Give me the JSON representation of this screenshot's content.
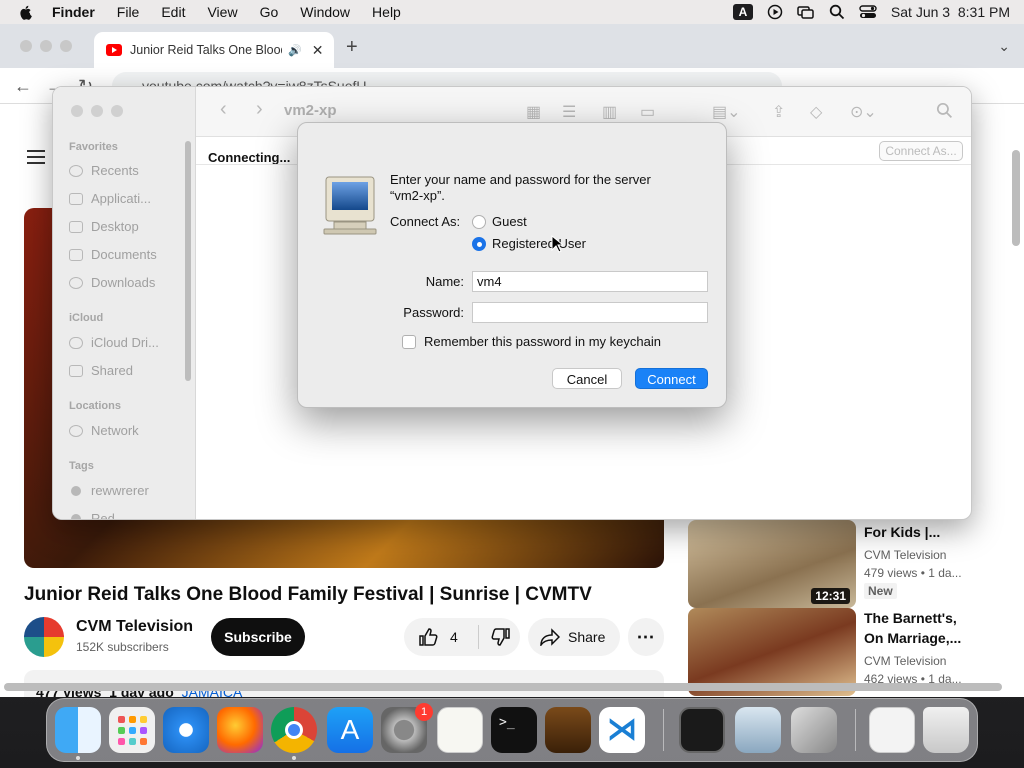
{
  "menubar": {
    "app_name": "Finder",
    "items": [
      "File",
      "Edit",
      "View",
      "Go",
      "Window",
      "Help"
    ],
    "input_source": "A",
    "datetime": "Sat Jun 3  8:31 PM"
  },
  "browser": {
    "tab_title": "Junior Reid Talks One Blood Family Festival | Sunrise | CVMTV",
    "url": "youtube.com/watch?v=jw8zTsSuefU"
  },
  "youtube": {
    "video_title": "Junior Reid Talks One Blood Family Festival | Sunrise | CVMTV",
    "channel_name": "CVM Television",
    "subscribers": "152K subscribers",
    "subscribe_label": "Subscribe",
    "likes": "4",
    "share_label": "Share",
    "views_date": "477 views  1 day ago",
    "location": "JAMAICA",
    "related": [
      {
        "title": "For Kids |...",
        "channel": "CVM Television",
        "meta": "479 views  • 1 da...",
        "duration": "12:31",
        "badge": "New"
      },
      {
        "title": "The Barnett's, On Marriage,...",
        "channel": "CVM Television",
        "meta": "462 views  • 1 da..."
      }
    ]
  },
  "finder": {
    "title": "vm2-xp",
    "status": "Connecting...",
    "connect_as_label": "Connect As...",
    "sidebar": {
      "favorites_header": "Favorites",
      "favorites": [
        "Recents",
        "Applicati...",
        "Desktop",
        "Documents",
        "Downloads"
      ],
      "icloud_header": "iCloud",
      "icloud": [
        "iCloud Dri...",
        "Shared"
      ],
      "locations_header": "Locations",
      "locations": [
        "Network"
      ],
      "tags_header": "Tags",
      "tags": [
        "rewwrerer",
        "Red"
      ]
    }
  },
  "dialog": {
    "message_line1": "Enter your name and password for the server",
    "message_line2": "“vm2-xp”.",
    "connect_as_label": "Connect As:",
    "option_guest": "Guest",
    "option_registered": "Registered User",
    "selected_option": "Registered User",
    "name_label": "Name:",
    "name_value": "vm4",
    "password_label": "Password:",
    "password_value": "",
    "remember_label": "Remember this password in my keychain",
    "remember_checked": false,
    "cancel_label": "Cancel",
    "connect_label": "Connect"
  },
  "dock": {
    "apps": [
      "finder-icon",
      "launchpad-icon",
      "safari-icon",
      "firefox-icon",
      "chrome-icon",
      "app-store-icon",
      "system-settings-icon",
      "textedit-icon",
      "terminal-icon",
      "garageband-icon",
      "vscode-icon",
      "activity-monitor-icon",
      "preview-icon",
      "migration-assistant-icon",
      "downloads-stack-icon",
      "trash-icon"
    ],
    "settings_badge": "1"
  },
  "colors": {
    "accent": "#1a82f7",
    "youtube_red": "#ff0000",
    "link": "#065fd4"
  }
}
